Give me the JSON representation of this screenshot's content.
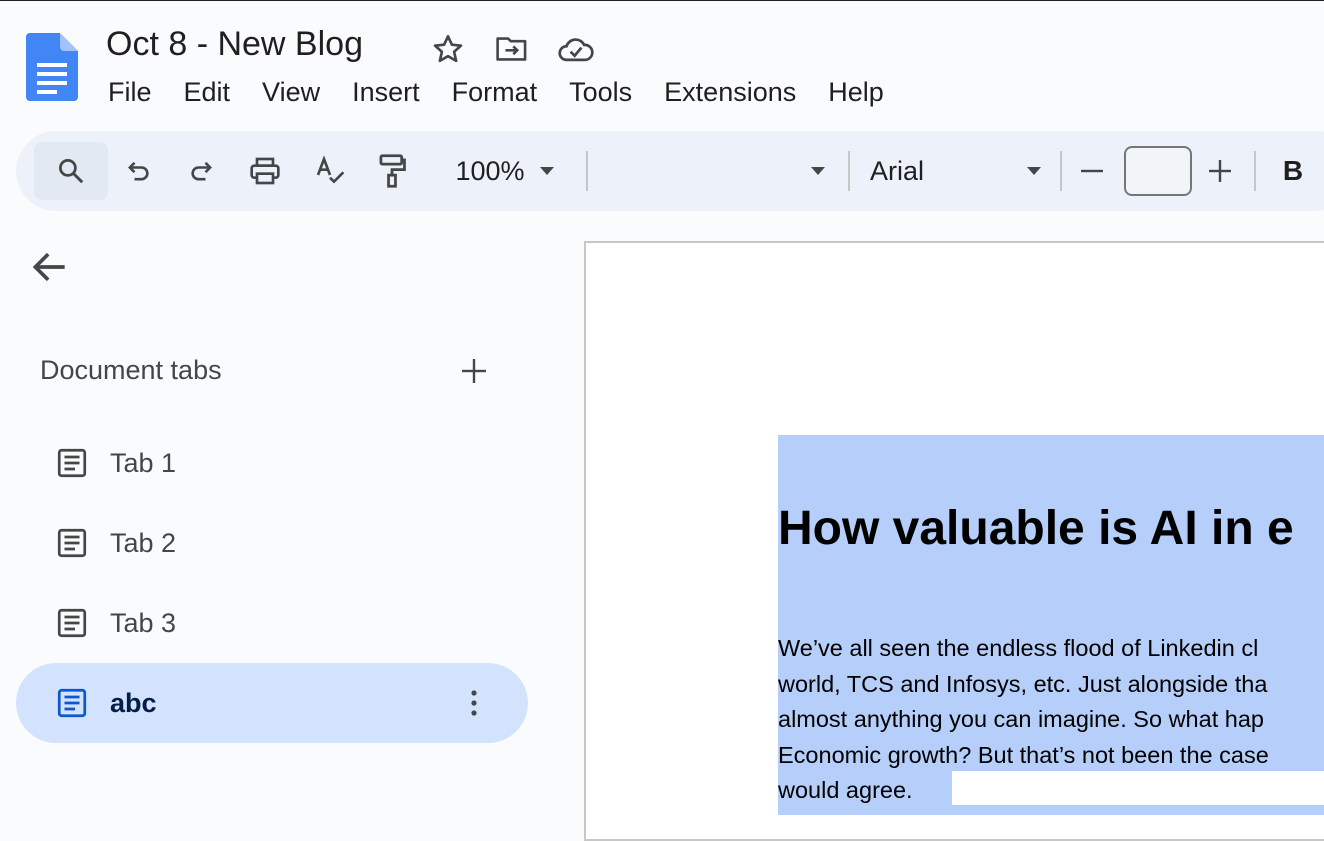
{
  "header": {
    "title": "Oct 8 - New Blog",
    "icons": [
      "star-icon",
      "move-to-folder-icon",
      "cloud-saved-icon"
    ]
  },
  "menubar": {
    "items": [
      "File",
      "Edit",
      "View",
      "Insert",
      "Format",
      "Tools",
      "Extensions",
      "Help"
    ]
  },
  "toolbar": {
    "zoom": "100%",
    "style": "",
    "font": "Arial",
    "font_size": "",
    "bold_label": "B",
    "icons": [
      "search-icon",
      "undo-icon",
      "redo-icon",
      "print-icon",
      "spellcheck-icon",
      "paint-format-icon"
    ]
  },
  "sidebar": {
    "heading": "Document tabs",
    "tabs": [
      {
        "label": "Tab 1",
        "active": false
      },
      {
        "label": "Tab 2",
        "active": false
      },
      {
        "label": "Tab 3",
        "active": false
      },
      {
        "label": "abc",
        "active": true
      }
    ]
  },
  "document": {
    "heading": "How valuable is AI in e",
    "paragraph_lines": [
      "We’ve all seen the endless flood of Linkedin cl",
      "world, TCS and Infosys, etc. Just alongside tha",
      "almost anything you can imagine. So what hap",
      "Economic growth? But that’s not been the case",
      "would agree."
    ]
  },
  "colors": {
    "doc_blue": "#4285f4",
    "toolbar_bg": "#edf2fa",
    "active_tab_bg": "#d3e3fd",
    "selection": "#b5cefa"
  }
}
